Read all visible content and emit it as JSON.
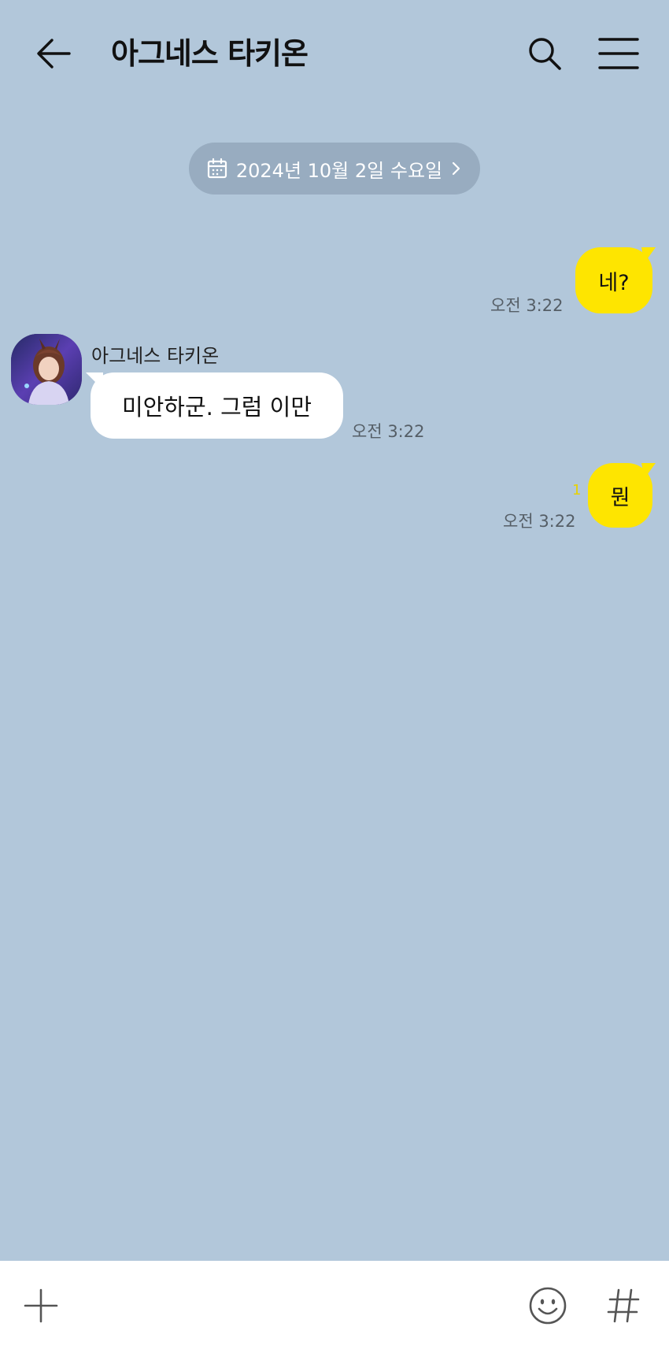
{
  "header": {
    "title": "아그네스 타키온",
    "back_icon": "arrow-left-icon",
    "search_icon": "search-icon",
    "menu_icon": "hamburger-menu-icon"
  },
  "date_divider": {
    "label": "2024년 10월 2일 수요일",
    "icon": "calendar-icon"
  },
  "messages": [
    {
      "from": "me",
      "text": "네?",
      "time": "오전 3:22"
    },
    {
      "from": "other",
      "sender": "아그네스 타키온",
      "text": "미안하군. 그럼 이만",
      "time": "오전 3:22"
    },
    {
      "from": "me",
      "text": "뭔",
      "time": "오전 3:22",
      "unread_count": "1"
    }
  ],
  "input_bar": {
    "plus_icon": "plus-icon",
    "emoji_icon": "emoji-icon",
    "hash_icon": "hashtag-icon"
  },
  "colors": {
    "background": "#b2c7da",
    "my_bubble": "#fee500",
    "other_bubble": "#ffffff",
    "unread": "#e8d200"
  }
}
